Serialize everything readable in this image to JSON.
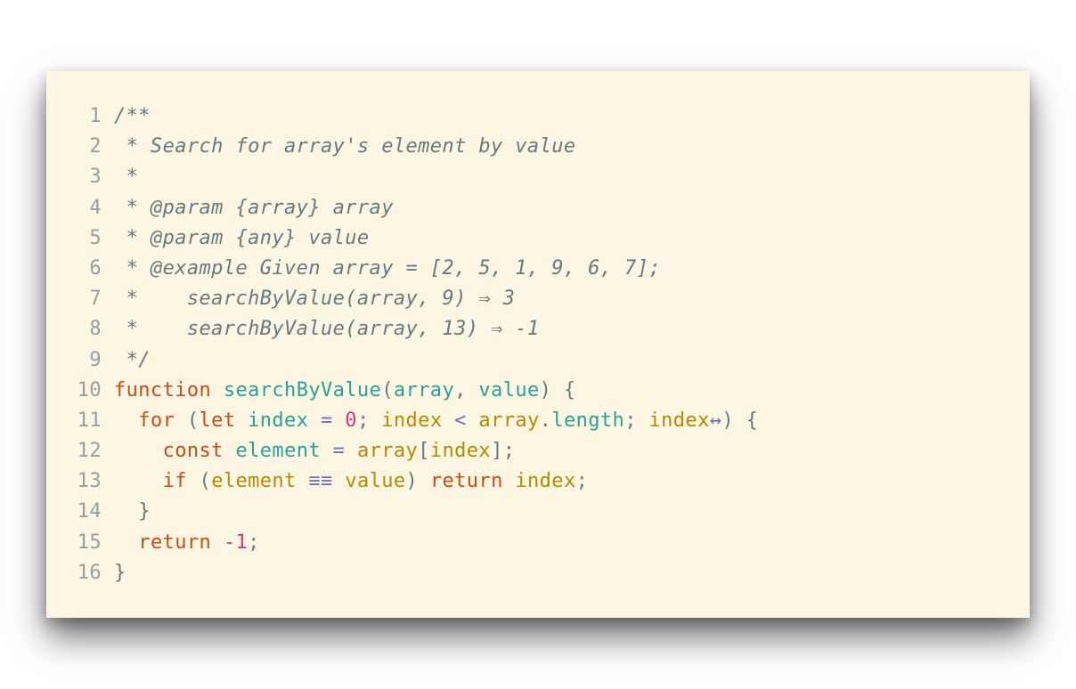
{
  "editor": {
    "lines": [
      {
        "n": "1",
        "tokens": [
          {
            "t": "/**",
            "c": "c"
          }
        ]
      },
      {
        "n": "2",
        "tokens": [
          {
            "t": " * Search for array's element by value",
            "c": "c"
          }
        ]
      },
      {
        "n": "3",
        "tokens": [
          {
            "t": " *",
            "c": "c"
          }
        ]
      },
      {
        "n": "4",
        "tokens": [
          {
            "t": " * @param {array} array",
            "c": "c"
          }
        ]
      },
      {
        "n": "5",
        "tokens": [
          {
            "t": " * @param {any} value",
            "c": "c"
          }
        ]
      },
      {
        "n": "6",
        "tokens": [
          {
            "t": " * @example Given array = [2, 5, 1, 9, 6, 7];",
            "c": "c"
          }
        ]
      },
      {
        "n": "7",
        "tokens": [
          {
            "t": " *    searchByValue(array, 9) ⇒ 3",
            "c": "c"
          }
        ]
      },
      {
        "n": "8",
        "tokens": [
          {
            "t": " *    searchByValue(array, 13) ⇒ -1",
            "c": "c"
          }
        ]
      },
      {
        "n": "9",
        "tokens": [
          {
            "t": " */",
            "c": "c"
          }
        ]
      },
      {
        "n": "10",
        "tokens": [
          {
            "t": "function",
            "c": "kw"
          },
          {
            "t": " ",
            "c": "pl"
          },
          {
            "t": "searchByValue",
            "c": "fn"
          },
          {
            "t": "(",
            "c": "pl"
          },
          {
            "t": "array",
            "c": "fn"
          },
          {
            "t": ", ",
            "c": "pl"
          },
          {
            "t": "value",
            "c": "fn"
          },
          {
            "t": ") {",
            "c": "pl"
          }
        ]
      },
      {
        "n": "11",
        "tokens": [
          {
            "t": "  ",
            "c": "pl"
          },
          {
            "t": "for",
            "c": "kw"
          },
          {
            "t": " (",
            "c": "pl"
          },
          {
            "t": "let",
            "c": "kw"
          },
          {
            "t": " ",
            "c": "pl"
          },
          {
            "t": "index",
            "c": "fn"
          },
          {
            "t": " = ",
            "c": "op"
          },
          {
            "t": "0",
            "c": "num"
          },
          {
            "t": "; ",
            "c": "pl"
          },
          {
            "t": "index",
            "c": "var"
          },
          {
            "t": " < ",
            "c": "op"
          },
          {
            "t": "array",
            "c": "var"
          },
          {
            "t": ".",
            "c": "pl"
          },
          {
            "t": "length",
            "c": "prop"
          },
          {
            "t": "; ",
            "c": "pl"
          },
          {
            "t": "index",
            "c": "var"
          },
          {
            "t": "↔",
            "c": "op"
          },
          {
            "t": ") {",
            "c": "pl"
          }
        ]
      },
      {
        "n": "12",
        "tokens": [
          {
            "t": "    ",
            "c": "pl"
          },
          {
            "t": "const",
            "c": "kw"
          },
          {
            "t": " ",
            "c": "pl"
          },
          {
            "t": "element",
            "c": "fn"
          },
          {
            "t": " = ",
            "c": "op"
          },
          {
            "t": "array",
            "c": "var"
          },
          {
            "t": "[",
            "c": "pl"
          },
          {
            "t": "index",
            "c": "var"
          },
          {
            "t": "];",
            "c": "pl"
          }
        ]
      },
      {
        "n": "13",
        "tokens": [
          {
            "t": "    ",
            "c": "pl"
          },
          {
            "t": "if",
            "c": "kw"
          },
          {
            "t": " (",
            "c": "pl"
          },
          {
            "t": "element",
            "c": "var"
          },
          {
            "t": " ≡≡ ",
            "c": "op"
          },
          {
            "t": "value",
            "c": "var"
          },
          {
            "t": ") ",
            "c": "pl"
          },
          {
            "t": "return",
            "c": "kw"
          },
          {
            "t": " ",
            "c": "pl"
          },
          {
            "t": "index",
            "c": "var"
          },
          {
            "t": ";",
            "c": "pl"
          }
        ]
      },
      {
        "n": "14",
        "tokens": [
          {
            "t": "  }",
            "c": "pl"
          }
        ]
      },
      {
        "n": "15",
        "tokens": [
          {
            "t": "  ",
            "c": "pl"
          },
          {
            "t": "return",
            "c": "kw"
          },
          {
            "t": " ",
            "c": "pl"
          },
          {
            "t": "-1",
            "c": "num"
          },
          {
            "t": ";",
            "c": "pl"
          }
        ]
      },
      {
        "n": "16",
        "tokens": [
          {
            "t": "}",
            "c": "pl"
          }
        ]
      }
    ]
  },
  "colors": {
    "background": "#fdf6e3",
    "line_number": "#93a1a1",
    "comment": "#657b83",
    "keyword": "#cb4b16",
    "identifier": "#2aa198",
    "variable": "#b58900",
    "number": "#d33682",
    "operator": "#6c71c4"
  }
}
